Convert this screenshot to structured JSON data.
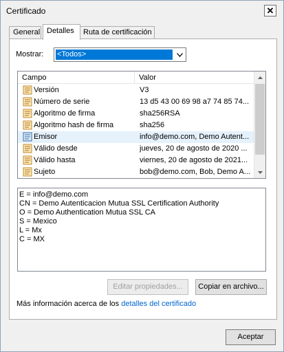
{
  "window": {
    "title": "Certificado",
    "close_glyph": "✕"
  },
  "tabs": [
    {
      "label": "General"
    },
    {
      "label": "Detalles"
    },
    {
      "label": "Ruta de certificación"
    }
  ],
  "filter": {
    "label": "Mostrar:",
    "selected": "<Todos>"
  },
  "list": {
    "col_field": "Campo",
    "col_value": "Valor",
    "rows": [
      {
        "field": "Versión",
        "value": "V3",
        "icon": "certificate-field-icon"
      },
      {
        "field": "Número de serie",
        "value": "13 d5 43 00 69 98 a7 74 85 74...",
        "icon": "certificate-field-icon"
      },
      {
        "field": "Algoritmo de firma",
        "value": "sha256RSA",
        "icon": "certificate-field-icon"
      },
      {
        "field": "Algoritmo hash de firma",
        "value": "sha256",
        "icon": "certificate-field-icon"
      },
      {
        "field": "Emisor",
        "value": "info@demo.com, Demo Autent...",
        "icon": "certificate-field-icon",
        "selected": true
      },
      {
        "field": "Válido desde",
        "value": "jueves, 20 de agosto de 2020 ...",
        "icon": "certificate-field-icon"
      },
      {
        "field": "Válido hasta",
        "value": "viernes, 20 de agosto de 2021...",
        "icon": "certificate-field-icon"
      },
      {
        "field": "Sujeto",
        "value": "bob@demo.com, Bob, Demo A...",
        "icon": "certificate-field-icon"
      }
    ]
  },
  "detail": {
    "lines": [
      "E = info@demo.com",
      "CN = Demo Autenticacion Mutua SSL Certification Authority",
      "O = Demo Authentication Mutua SSL CA",
      "S = Mexico",
      "L = Mx",
      "C = MX"
    ]
  },
  "buttons": {
    "edit": "Editar propiedades...",
    "copy": "Copiar en archivo...",
    "accept": "Aceptar"
  },
  "info": {
    "prefix": "Más información acerca de los ",
    "link": "detalles del certificado"
  }
}
